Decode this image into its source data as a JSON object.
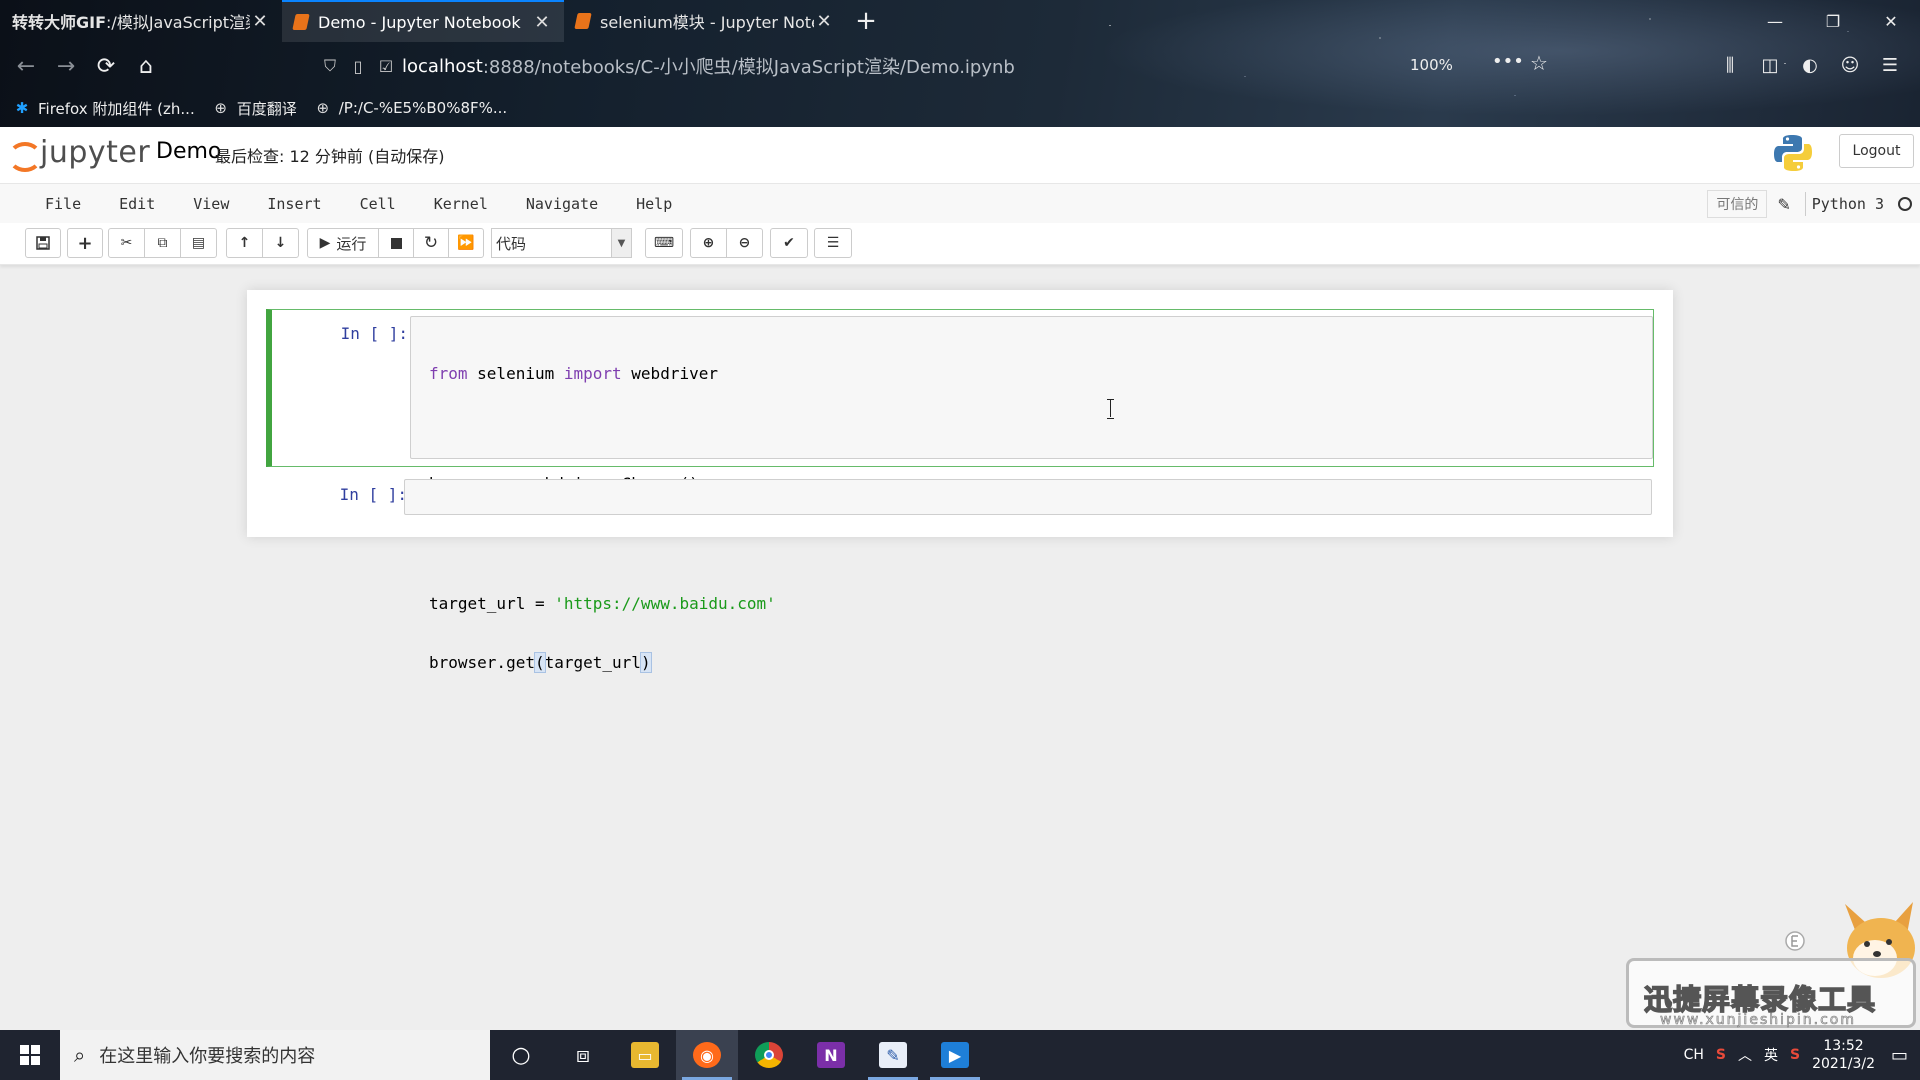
{
  "browser": {
    "tabs": [
      {
        "title_bold": "转转大师GIF",
        "title_rest": ":/模拟JavaScript渲染",
        "active": false
      },
      {
        "title": "Demo - Jupyter Notebook",
        "active": true
      },
      {
        "title": "selenium模块 - Jupyter Notebook",
        "active": false
      }
    ],
    "new_tab": "+",
    "window_controls": {
      "minimize": "—",
      "restore": "❐",
      "close": "✕"
    },
    "url_host": "localhost",
    "url_path": ":8888/notebooks/C-小小爬虫/模拟JavaScript渲染/Demo.ipynb",
    "zoom": "100%",
    "more": "•••",
    "bookmarks": [
      {
        "label": "Firefox 附加组件 (zh...",
        "icon": "puzzle-icon"
      },
      {
        "label": "百度翻译",
        "icon": "globe-icon"
      },
      {
        "label": "/P:/C-%E5%B0%8F%...",
        "icon": "globe-icon"
      }
    ]
  },
  "jupyter": {
    "logo_text": "jupyter",
    "notebook_name": "Demo",
    "checkpoint": "最后检查: 12 分钟前 (自动保存)",
    "logout": "Logout",
    "menu": [
      "File",
      "Edit",
      "View",
      "Insert",
      "Cell",
      "Kernel",
      "Navigate",
      "Help"
    ],
    "trusted": "可信的",
    "kernel": "Python 3",
    "toolbar": {
      "run_label": "运行",
      "cell_type": "代码"
    },
    "cells": [
      {
        "prompt": "In [ ]:",
        "lines": {
          "l1_kw1": "from",
          "l1_mid": " selenium ",
          "l1_kw2": "import",
          "l1_end": " webdriver",
          "l2": "browser = webdriver.Chrome()",
          "l3_a": "target_url = ",
          "l3_str": "'https://www.baidu.com'",
          "l4_a": "browser.get",
          "l4_open": "(",
          "l4_arg": "target_url",
          "l4_close": ")"
        }
      },
      {
        "prompt": "In [ ]:"
      }
    ]
  },
  "watermark": {
    "title": "迅捷屏幕录像工具",
    "url": "www.xunjieshipin.com"
  },
  "taskbar": {
    "search_placeholder": "在这里输入你要搜索的内容",
    "tray_lang": "CH",
    "tray_input": "英",
    "time": "13:52",
    "date": "2021/3/2"
  }
}
